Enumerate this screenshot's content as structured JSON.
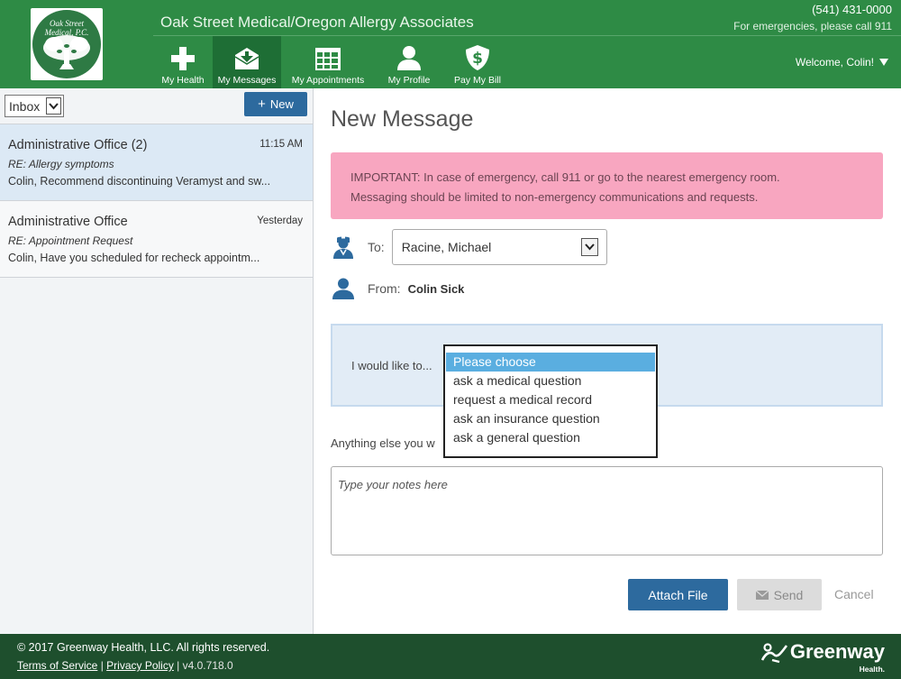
{
  "header": {
    "org_name": "Oak Street Medical/Oregon Allergy Associates",
    "logo_text_line1": "Oak Street",
    "logo_text_line2": "Medical, P.C.",
    "phone": "(541) 431-0000",
    "emergency": "For emergencies, please call 911",
    "welcome": "Welcome, Colin!",
    "brand_color": "#2e8b45"
  },
  "nav": {
    "items": [
      {
        "label": "My Health",
        "icon": "plus-icon"
      },
      {
        "label": "My Messages",
        "icon": "inbox-icon",
        "active": true
      },
      {
        "label": "My Appointments",
        "icon": "calendar-icon"
      },
      {
        "label": "My Profile",
        "icon": "person-icon"
      },
      {
        "label": "Pay My Bill",
        "icon": "dollar-shield-icon"
      }
    ]
  },
  "sidebar": {
    "folder": "Inbox",
    "new_label": "New",
    "messages": [
      {
        "from": "Administrative Office (2)",
        "time": "11:15 AM",
        "subject": "RE: Allergy symptoms",
        "preview": "Colin, Recommend discontinuing Veramyst and sw..."
      },
      {
        "from": "Administrative Office",
        "time": "Yesterday",
        "subject": "RE: Appointment Request",
        "preview": "Colin, Have you scheduled for recheck appointm..."
      }
    ]
  },
  "main": {
    "title": "New Message",
    "alert_line1": "IMPORTANT: In case of emergency, call 911 or go to the nearest emergency room.",
    "alert_line2": "Messaging should be limited to non-emergency communications and requests.",
    "to_label": "To:",
    "to_value": "Racine, Michael",
    "from_label": "From:",
    "from_value": "Colin Sick",
    "choose_label": "I would like to...",
    "options": [
      "Please choose",
      "ask a medical question",
      "request a medical record",
      "ask an insurance question",
      "ask a general question"
    ],
    "anything_label": "Anything else you w",
    "notes_placeholder": "Type your notes here",
    "attach_label": "Attach File",
    "send_label": "Send",
    "cancel_label": "Cancel"
  },
  "footer": {
    "copyright": "© 2017 Greenway Health, LLC. All rights reserved.",
    "terms": "Terms of Service",
    "sep": " | ",
    "privacy": "Privacy Policy",
    "version": " | v4.0.718.0",
    "brand": "Greenway",
    "brand_sub": "Health."
  }
}
